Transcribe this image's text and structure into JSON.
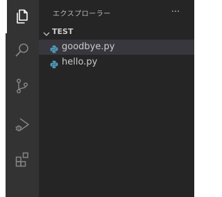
{
  "activity_bar": {
    "items": [
      {
        "name": "explorer-icon",
        "active": true
      },
      {
        "name": "search-icon",
        "active": false
      },
      {
        "name": "source-control-icon",
        "active": false
      },
      {
        "name": "run-debug-icon",
        "active": false
      },
      {
        "name": "extensions-icon",
        "active": false
      }
    ],
    "background": "#333333",
    "active_icon_color": "#ffffff",
    "inactive_icon_color": "#858585"
  },
  "sidebar": {
    "title": "エクスプローラー",
    "more_actions": "···",
    "background": "#252526",
    "section": {
      "title": "TEST",
      "expanded": true
    },
    "files": [
      {
        "name": "goodbye.py",
        "icon": "python-file-icon",
        "selected": true
      },
      {
        "name": "hello.py",
        "icon": "python-file-icon",
        "selected": false
      }
    ],
    "selection_color": "#37373d"
  }
}
